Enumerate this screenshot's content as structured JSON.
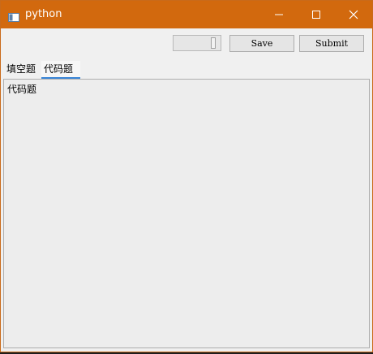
{
  "window": {
    "title": "python",
    "app_icon": "window-app-icon",
    "controls": {
      "minimize_icon": "minimize-icon",
      "maximize_icon": "maximize-icon",
      "close_icon": "close-icon"
    },
    "titlebar_color": "#d2690e"
  },
  "toolbar": {
    "save_label": "Save",
    "submit_label": "Submit"
  },
  "tabs": [
    {
      "label": "填空题",
      "selected": false
    },
    {
      "label": "代码题",
      "selected": true
    }
  ],
  "content": {
    "label": "代码题"
  },
  "accent_color": "#3a86d8"
}
